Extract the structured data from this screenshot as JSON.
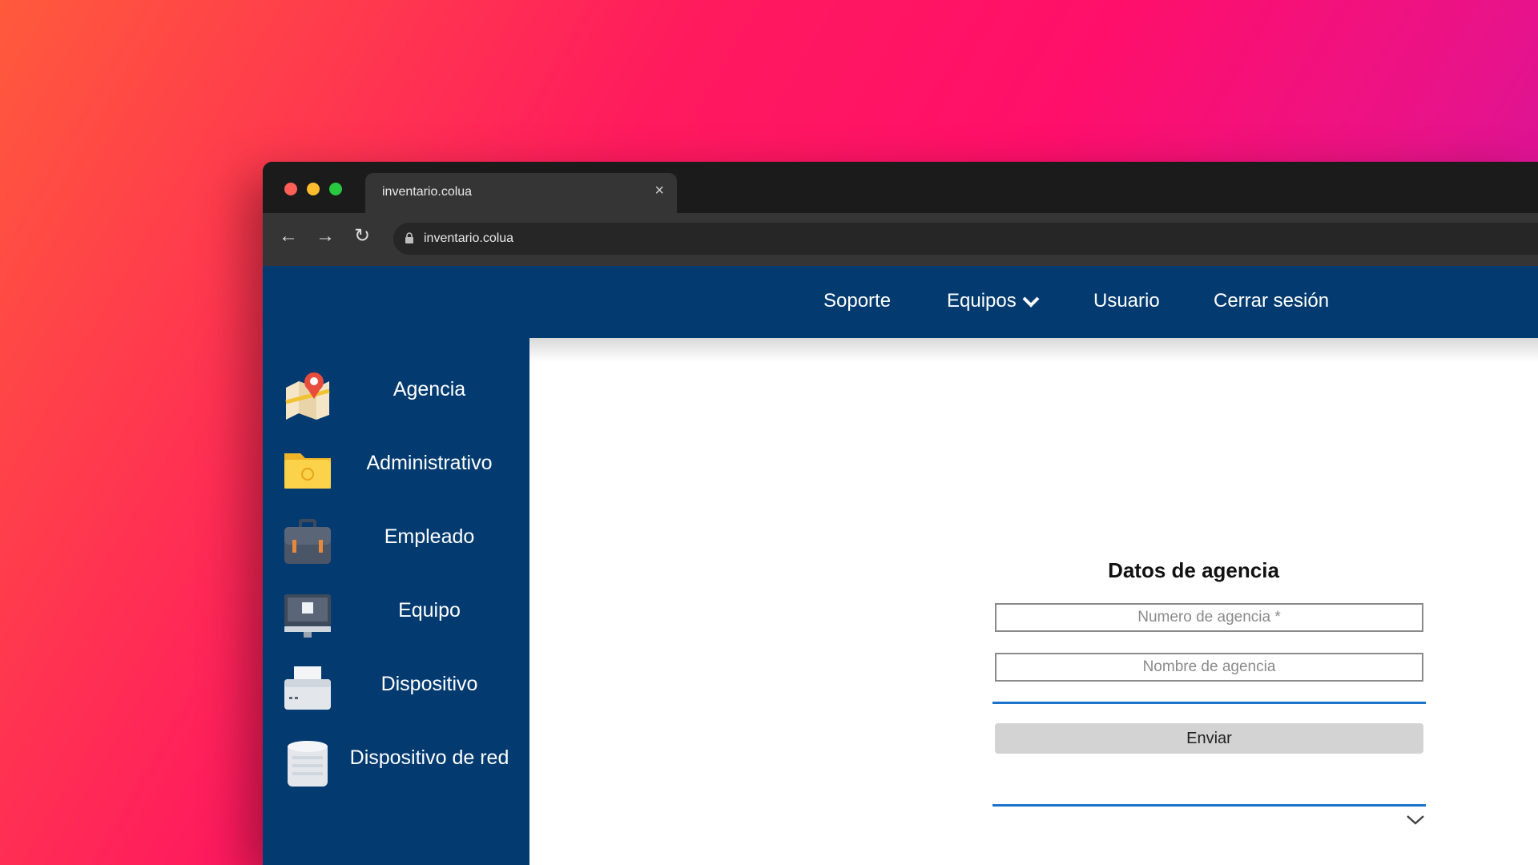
{
  "browser": {
    "tab_title": "inventario.colua",
    "url": "inventario.colua"
  },
  "topnav": {
    "items": [
      {
        "label": "Soporte"
      },
      {
        "label": "Equipos"
      },
      {
        "label": "Usuario"
      },
      {
        "label": "Cerrar sesión"
      }
    ]
  },
  "sidebar": {
    "items": [
      {
        "label": "Agencia",
        "icon": "map-pin-icon"
      },
      {
        "label": "Administrativo",
        "icon": "folder-icon"
      },
      {
        "label": "Empleado",
        "icon": "briefcase-icon"
      },
      {
        "label": "Equipo",
        "icon": "monitor-icon"
      },
      {
        "label": "Dispositivo",
        "icon": "printer-icon"
      },
      {
        "label": "Dispositivo de red",
        "icon": "server-icon"
      }
    ]
  },
  "form": {
    "title": "Datos de agencia",
    "numero_placeholder": "Numero de agencia *",
    "nombre_placeholder": "Nombre de agencia",
    "submit_label": "Enviar"
  },
  "colors": {
    "nav_bg": "#033b71",
    "accent_line": "#1a73c8",
    "button_bg": "#d3d3d3"
  }
}
